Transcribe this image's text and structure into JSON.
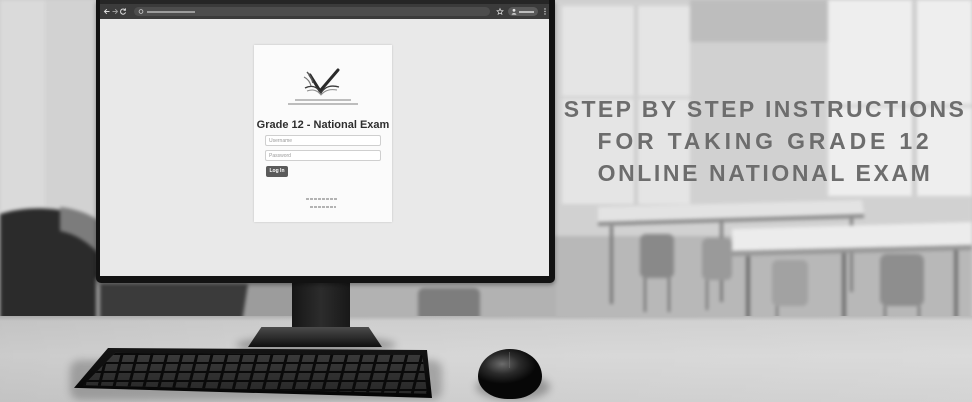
{
  "banner": {
    "headline_lines": [
      "STEP BY STEP INSTRUCTIONS",
      "FOR TAKING GRADE 12",
      "ONLINE NATIONAL EXAM"
    ]
  },
  "browser": {
    "nav_icons": [
      "back-arrow-icon",
      "forward-arrow-icon",
      "reload-icon",
      "site-info-icon"
    ],
    "toolbar_icons": [
      "bookmark-star-icon",
      "profile-icon",
      "menu-kebab-icon"
    ]
  },
  "login_page": {
    "logo_icon": "open-book-logo-icon",
    "title": "Grade 12 - National Exam",
    "username_placeholder": "Username",
    "password_placeholder": "Password",
    "login_label": "Log In"
  },
  "theme": {
    "headline_color": "#6d6d6d",
    "button_color": "#5a5a5a",
    "toolbar_color": "#3b3b3b",
    "page_background": "#e9e9e9"
  }
}
